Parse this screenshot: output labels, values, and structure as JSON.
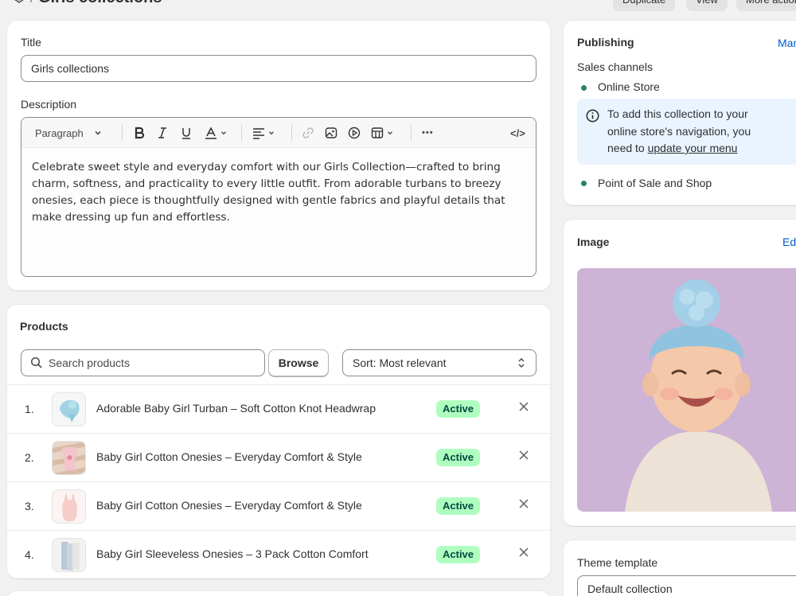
{
  "header": {
    "page_title": "Girls collections",
    "separator": "/",
    "actions": {
      "duplicate": "Duplicate",
      "view": "View",
      "more": "More actions"
    }
  },
  "details": {
    "title_label": "Title",
    "title_value": "Girls collections",
    "description_label": "Description",
    "toolbar": {
      "paragraph": "Paragraph",
      "more": "•••",
      "code": "</>"
    },
    "description_text": "Celebrate sweet style and everyday comfort with our Girls Collection—crafted to bring charm, softness, and practicality to every little outfit. From adorable turbans to breezy onesies, each piece is thoughtfully designed with gentle fabrics and playful details that make dressing up fun and effortless."
  },
  "products": {
    "heading": "Products",
    "search_placeholder": "Search products",
    "browse_label": "Browse",
    "sort_label": "Sort: Most relevant",
    "items": [
      {
        "num": "1.",
        "name": "Adorable Baby Girl Turban – Soft Cotton Knot Headwrap",
        "status": "Active"
      },
      {
        "num": "2.",
        "name": "Baby Girl Cotton Onesies – Everyday Comfort & Style",
        "status": "Active"
      },
      {
        "num": "3.",
        "name": "Baby Girl Cotton Onesies – Everyday Comfort & Style",
        "status": "Active"
      },
      {
        "num": "4.",
        "name": "Baby Girl Sleeveless Onesies – 3 Pack Cotton Comfort",
        "status": "Active"
      }
    ]
  },
  "publishing": {
    "heading": "Publishing",
    "manage_link": "Manage",
    "sales_channels_label": "Sales channels",
    "channels": [
      "Online Store",
      "Point of Sale and Shop"
    ],
    "banner_text_before": "To add this collection to your online store's navigation, you need to ",
    "banner_link": "update your menu"
  },
  "image_card": {
    "heading": "Image",
    "edit_link": "Edit"
  },
  "theme": {
    "label": "Theme template",
    "value": "Default collection"
  },
  "colors": {
    "accent_link": "#005bd3",
    "active_badge_bg": "#affebf",
    "active_badge_text": "#014b40",
    "status_dot": "#29845a",
    "banner_bg": "#eaf4ff"
  },
  "icons": [
    "collection-icon",
    "info-icon",
    "search-icon",
    "close-icon",
    "chevron-down-icon",
    "sort-icon"
  ]
}
